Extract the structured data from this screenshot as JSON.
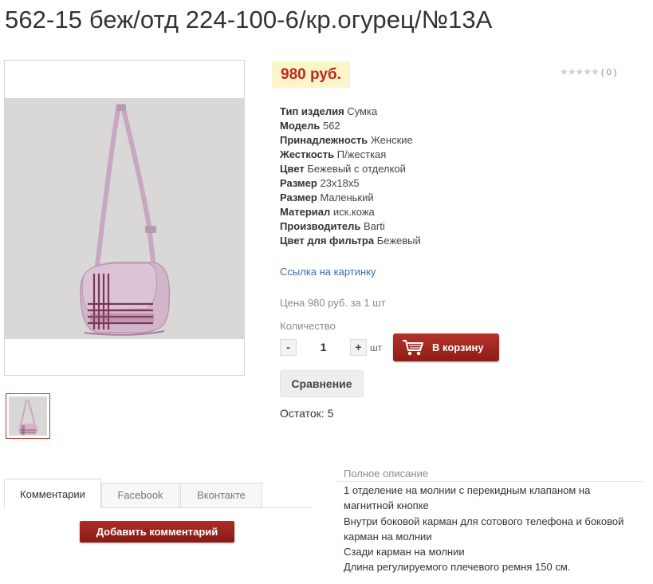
{
  "product": {
    "title": "562-15 беж/отд 224-100-6/кр.огурец/№13А",
    "price": "980 руб.",
    "rating": {
      "stars": 0,
      "count_text": "( 0 )"
    },
    "properties": [
      {
        "key": "Тип изделия",
        "value": "Сумка"
      },
      {
        "key": "Модель",
        "value": "562"
      },
      {
        "key": "Принадлежность",
        "value": "Женские"
      },
      {
        "key": "Жесткость",
        "value": "П/жесткая"
      },
      {
        "key": "Цвет",
        "value": "Бежевый с отделкой"
      },
      {
        "key": "Размер",
        "value": "23х18х5"
      },
      {
        "key": "Размер",
        "value": "Маленький"
      },
      {
        "key": "Материал",
        "value": "иск.кожа"
      },
      {
        "key": "Производитель",
        "value": "Barti"
      },
      {
        "key": "Цвет для фильтра",
        "value": "Бежевый"
      }
    ],
    "image_link": "Ссылка на картинку",
    "unit_price": "Цена 980 руб. за 1 шт",
    "quantity_label": "Количество",
    "quantity_value": "1",
    "minus_label": "-",
    "plus_label": "+",
    "unit_label": "шт",
    "cart_button": "В корзину",
    "compare_button": "Сравнение",
    "stock": "Остаток: 5"
  },
  "tabs": [
    {
      "label": "Комментарии",
      "active": true
    },
    {
      "label": "Facebook",
      "active": false
    },
    {
      "label": "Вконтакте",
      "active": false
    }
  ],
  "add_comment_button": "Добавить комментарий",
  "description": {
    "title": "Полное описание",
    "lines": [
      "1 отделение на молнии с перекидным клапаном на магнитной кнопке",
      "Внутри боковой карман для сотового телефона и боковой карман на молнии",
      "Сзади карман на молнии",
      "Длина регулируемого плечевого ремня 150 см."
    ]
  },
  "colors": {
    "price_color": "#c0271d",
    "price_bg": "#fbf5c9",
    "button_red": "#9e2820",
    "link_blue": "#3d6ea8",
    "bag_color": "#d4b6cd"
  },
  "icons": {
    "cart": "shopping-cart-icon",
    "star": "star-icon"
  }
}
